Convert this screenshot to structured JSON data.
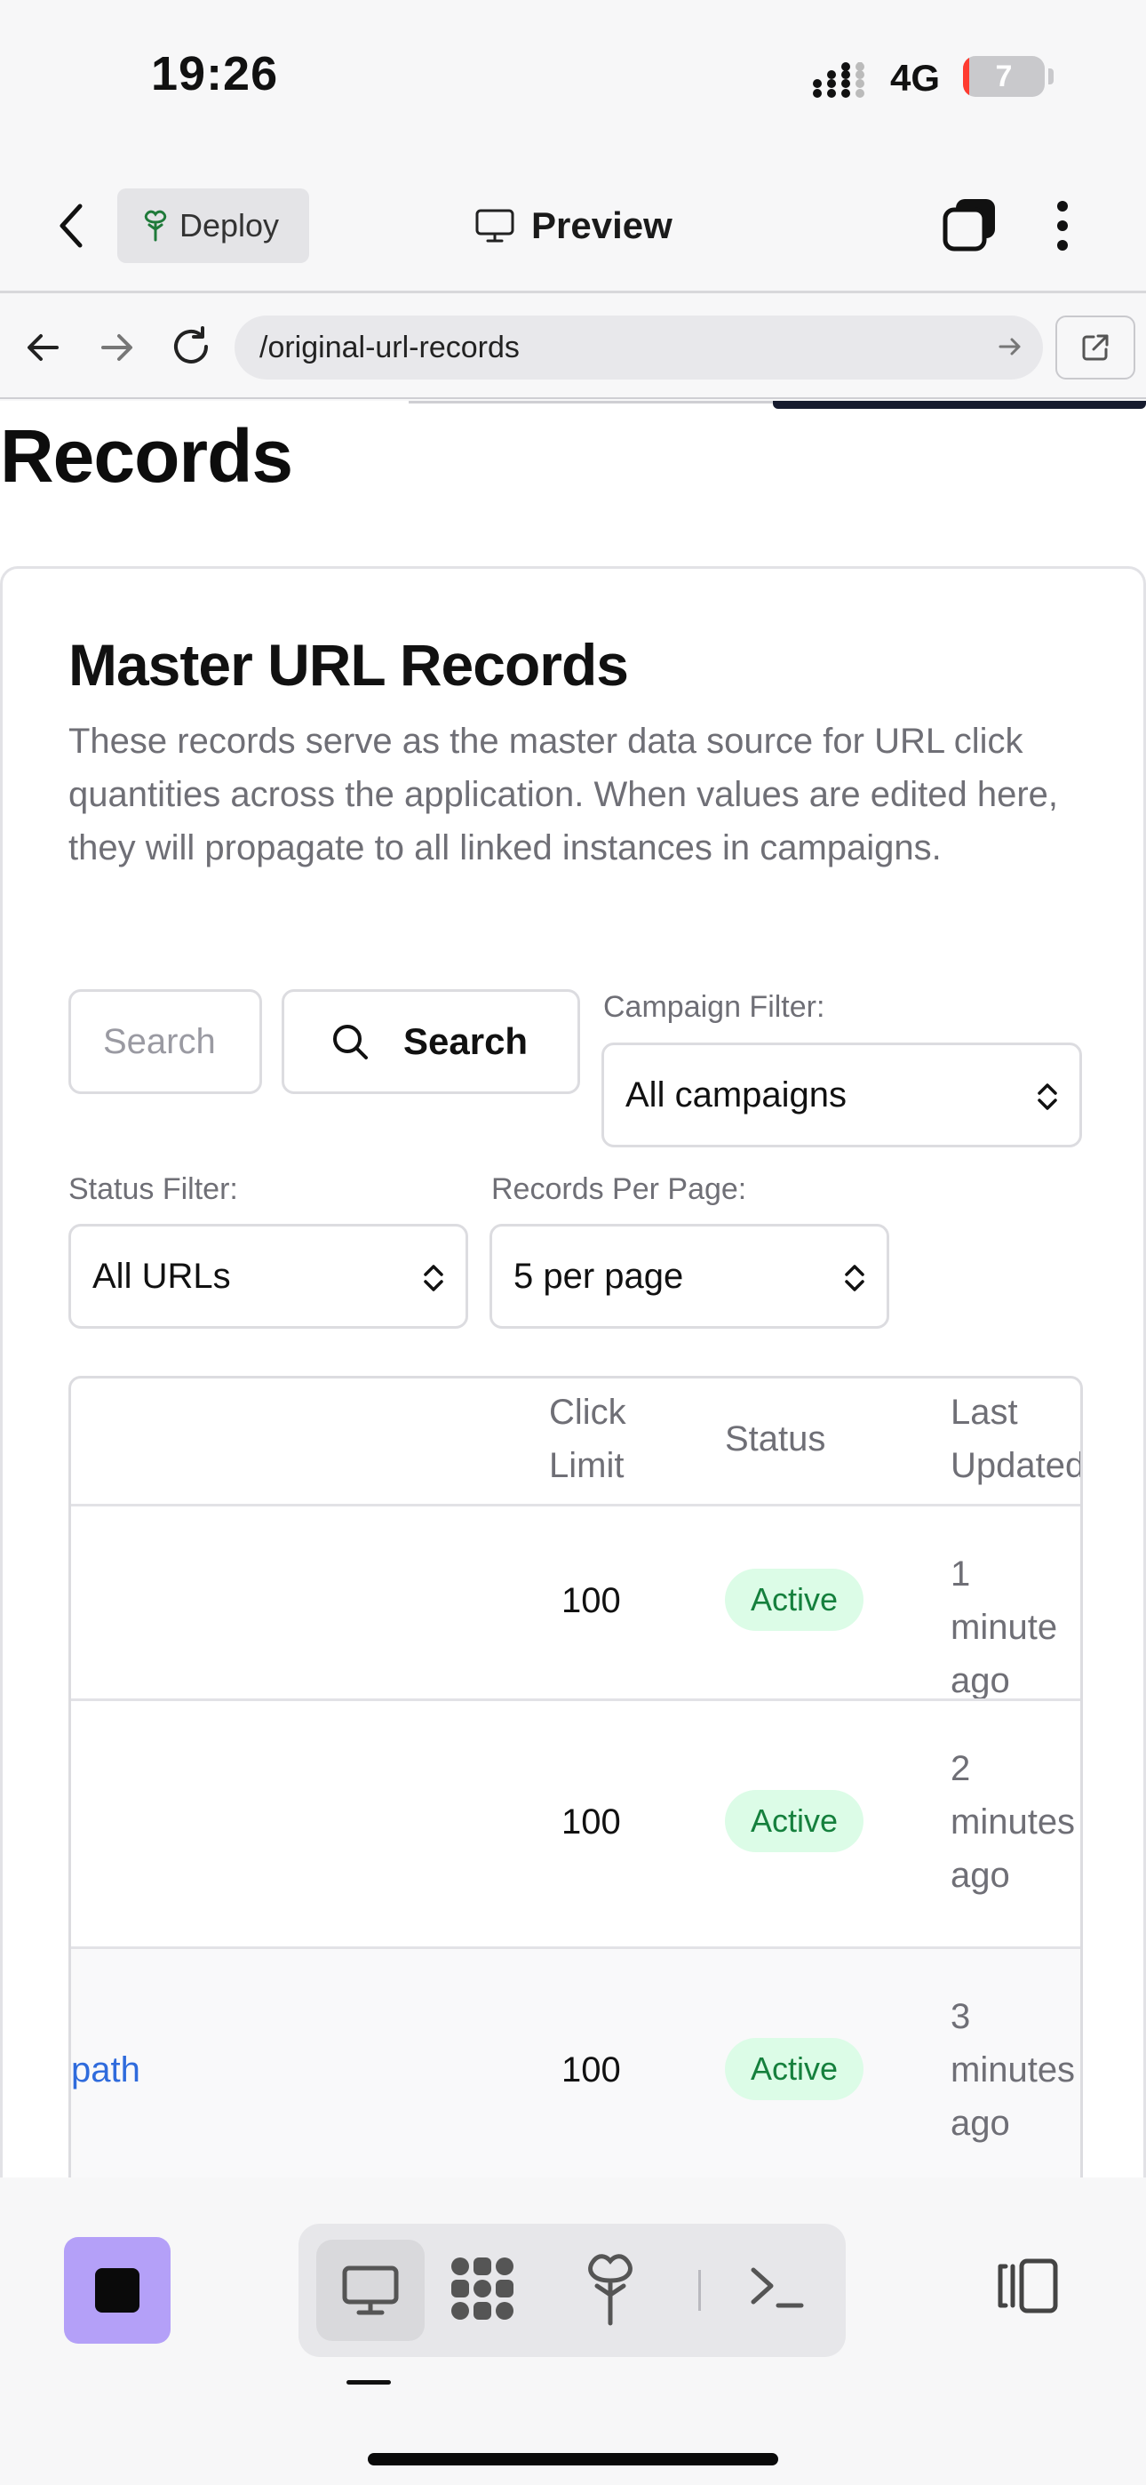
{
  "status_bar": {
    "time": "19:26",
    "network": "4G",
    "battery": "7",
    "battery_level": 0.07
  },
  "app_bar": {
    "deploy_label": "Deploy",
    "preview_label": "Preview"
  },
  "browser": {
    "url": "/original-url-records"
  },
  "page": {
    "heading": "Records",
    "card": {
      "title": "Master URL Records",
      "description": "These records serve as the master data source for URL click quantities across the application. When values are edited here, they will propagate to all linked instances in campaigns."
    },
    "search": {
      "placeholder": "Search",
      "button_label": "Search"
    },
    "campaign_filter": {
      "label": "Campaign Filter:",
      "value": "All campaigns"
    },
    "status_filter": {
      "label": "Status Filter:",
      "value": "All URLs"
    },
    "per_page": {
      "label": "Records Per Page:",
      "value": "5 per page"
    },
    "table": {
      "headers": {
        "click_limit": "Click\nLimit",
        "status": "Status",
        "last_updated": "Last\nUpdated"
      },
      "rows": [
        {
          "url": "",
          "click_limit": "100",
          "status": "Active",
          "last_updated": "1 minute\nago"
        },
        {
          "url": "",
          "click_limit": "100",
          "status": "Active",
          "last_updated": "2\nminutes\nago"
        },
        {
          "url": "path",
          "click_limit": "100",
          "status": "Active",
          "last_updated": "3\nminutes\nago"
        }
      ]
    }
  },
  "colors": {
    "accent_purple": "#b4a0f8",
    "status_green_bg": "#dcfce7",
    "status_green_text": "#15803d",
    "link_blue": "#2f6bdc",
    "battery_red": "#ff3b30"
  },
  "icons": {
    "back": "chevron-left-icon",
    "deploy": "deploy-tree-icon",
    "preview": "monitor-icon",
    "tabs": "tabs-icon",
    "menu": "more-vertical-icon",
    "terminal": "terminal-icon",
    "split": "split-view-icon"
  }
}
